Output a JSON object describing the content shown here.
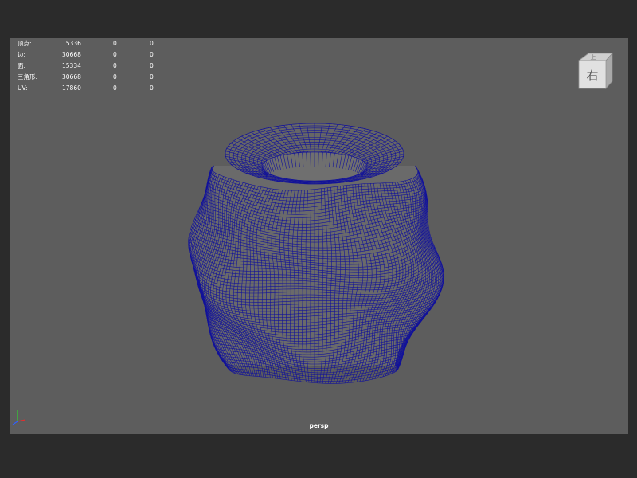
{
  "hud": {
    "rows": [
      {
        "label": "顶点:",
        "v1": "15336",
        "v2": "0",
        "v3": "0"
      },
      {
        "label": "边:",
        "v1": "30668",
        "v2": "0",
        "v3": "0"
      },
      {
        "label": "面:",
        "v1": "15334",
        "v2": "0",
        "v3": "0"
      },
      {
        "label": "三角形:",
        "v1": "30668",
        "v2": "0",
        "v3": "0"
      },
      {
        "label": "UV:",
        "v1": "17860",
        "v2": "0",
        "v3": "0"
      }
    ]
  },
  "viewcube": {
    "face_label": "右",
    "top_label": "上",
    "icon": "view-cube-icon"
  },
  "camera": {
    "label": "persp"
  },
  "axis_indicator": {
    "icon": "axis-gizmo-icon",
    "colors": {
      "x": "#e03030",
      "y": "#30d030",
      "z": "#3060ff"
    }
  },
  "mesh": {
    "icon": "wireframe-mesh-icon",
    "wire_color": "#12129a"
  },
  "colors": {
    "viewport_bg": "#5d5d5d",
    "frame_bg": "#2b2b2b"
  }
}
